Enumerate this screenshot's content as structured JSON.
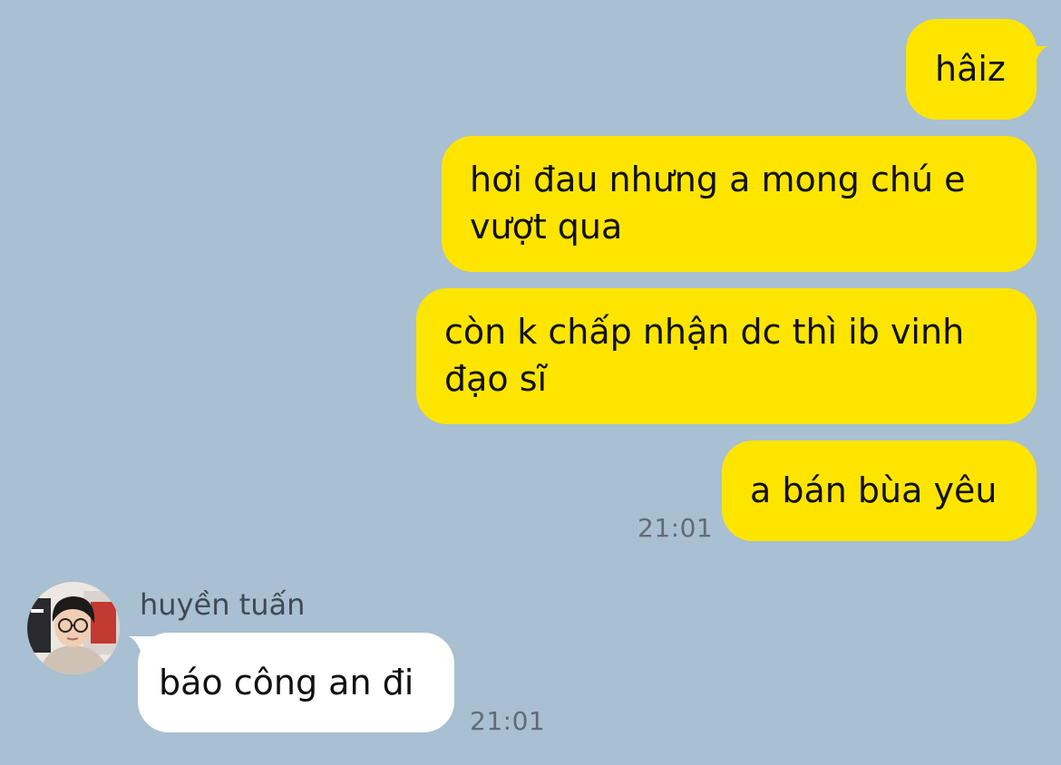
{
  "messages": [
    {
      "direction": "outgoing",
      "text": "hâiz"
    },
    {
      "direction": "outgoing",
      "text": "hơi đau nhưng a mong chú e\nvượt qua"
    },
    {
      "direction": "outgoing",
      "text": "còn k chấp nhận dc thì ib vinh\nđạo sĩ"
    },
    {
      "direction": "outgoing",
      "text": "a bán bùa yêu",
      "time": "21:01"
    },
    {
      "direction": "incoming",
      "sender": "huyền tuấn",
      "text": "báo công an đi",
      "time": "21:01"
    }
  ],
  "colors": {
    "background": "#a9bfd2",
    "outgoing_bubble": "#fee500",
    "incoming_bubble": "#ffffff",
    "timestamp": "#5f6c78"
  }
}
